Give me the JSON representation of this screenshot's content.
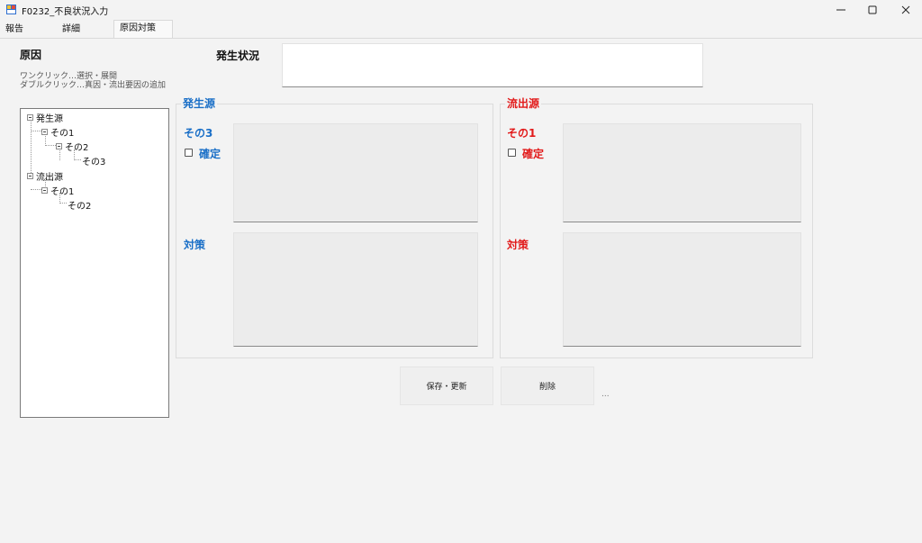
{
  "window": {
    "title": "F0232_不良状況入力"
  },
  "tabs": [
    {
      "label": "報告"
    },
    {
      "label": "詳細"
    },
    {
      "label": "原因対策"
    }
  ],
  "cause_panel": {
    "title": "原因",
    "hint_lines": [
      "ワンクリック…選択・展開",
      "ダブルクリック…真因・流出要因の追加"
    ]
  },
  "tree": {
    "nodes": [
      {
        "label": "発生源"
      },
      {
        "label": "その1"
      },
      {
        "label": "その2"
      },
      {
        "label": "その3"
      },
      {
        "label": "流出源"
      },
      {
        "label": "その1"
      },
      {
        "label": "その2"
      }
    ]
  },
  "occurrence": {
    "label": "発生状況",
    "value": ""
  },
  "source_group": {
    "title": "発生源",
    "item": "その3",
    "confirm_label": "確定",
    "confirm_checked": false,
    "countermeasure_label": "対策",
    "color": "#1a6fc7"
  },
  "outflow_group": {
    "title": "流出源",
    "item": "その1",
    "confirm_label": "確定",
    "confirm_checked": false,
    "countermeasure_label": "対策",
    "color": "#e21b1b"
  },
  "actions": {
    "save_label": "保存・更新",
    "delete_label": "削除",
    "more_label": "..."
  }
}
